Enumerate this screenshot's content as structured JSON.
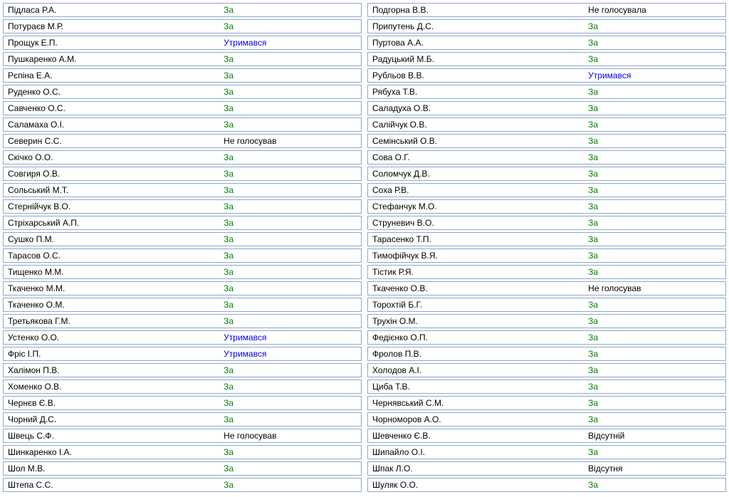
{
  "vote_classes": {
    "За": "vote-for",
    "Утримався": "vote-abstain",
    "Не голосував": "vote-novote",
    "Не голосувала": "vote-novote",
    "Відсутній": "vote-absent",
    "Відсутня": "vote-absent"
  },
  "left": [
    {
      "name": "Підласа Р.А.",
      "vote": "За"
    },
    {
      "name": "Потураєв М.Р.",
      "vote": "За"
    },
    {
      "name": "Прощук Е.П.",
      "vote": "Утримався"
    },
    {
      "name": "Пушкаренко А.М.",
      "vote": "За"
    },
    {
      "name": "Рєпіна Е.А.",
      "vote": "За"
    },
    {
      "name": "Руденко О.С.",
      "vote": "За"
    },
    {
      "name": "Савченко О.С.",
      "vote": "За"
    },
    {
      "name": "Саламаха О.І.",
      "vote": "За"
    },
    {
      "name": "Северин С.С.",
      "vote": "Не голосував"
    },
    {
      "name": "Скічко О.О.",
      "vote": "За"
    },
    {
      "name": "Совгиря О.В.",
      "vote": "За"
    },
    {
      "name": "Сольський М.Т.",
      "vote": "За"
    },
    {
      "name": "Стернійчук В.О.",
      "vote": "За"
    },
    {
      "name": "Стріхарський А.П.",
      "vote": "За"
    },
    {
      "name": "Сушко П.М.",
      "vote": "За"
    },
    {
      "name": "Тарасов О.С.",
      "vote": "За"
    },
    {
      "name": "Тищенко М.М.",
      "vote": "За"
    },
    {
      "name": "Ткаченко М.М.",
      "vote": "За"
    },
    {
      "name": "Ткаченко О.М.",
      "vote": "За"
    },
    {
      "name": "Третьякова Г.М.",
      "vote": "За"
    },
    {
      "name": "Устенко О.О.",
      "vote": "Утримався"
    },
    {
      "name": "Фріс І.П.",
      "vote": "Утримався"
    },
    {
      "name": "Халімон П.В.",
      "vote": "За"
    },
    {
      "name": "Хоменко О.В.",
      "vote": "За"
    },
    {
      "name": "Чернєв Є.В.",
      "vote": "За"
    },
    {
      "name": "Чорний Д.С.",
      "vote": "За"
    },
    {
      "name": "Швець С.Ф.",
      "vote": "Не голосував"
    },
    {
      "name": "Шинкаренко І.А.",
      "vote": "За"
    },
    {
      "name": "Шол М.В.",
      "vote": "За"
    },
    {
      "name": "Штепа С.С.",
      "vote": "За"
    }
  ],
  "right": [
    {
      "name": "Подгорна В.В.",
      "vote": "Не голосувала"
    },
    {
      "name": "Припутень Д.С.",
      "vote": "За"
    },
    {
      "name": "Пуртова А.А.",
      "vote": "За"
    },
    {
      "name": "Радуцький М.Б.",
      "vote": "За"
    },
    {
      "name": "Рубльов В.В.",
      "vote": "Утримався"
    },
    {
      "name": "Рябуха Т.В.",
      "vote": "За"
    },
    {
      "name": "Саладуха О.В.",
      "vote": "За"
    },
    {
      "name": "Салійчук О.В.",
      "vote": "За"
    },
    {
      "name": "Семінський О.В.",
      "vote": "За"
    },
    {
      "name": "Сова О.Г.",
      "vote": "За"
    },
    {
      "name": "Соломчук Д.В.",
      "vote": "За"
    },
    {
      "name": "Соха Р.В.",
      "vote": "За"
    },
    {
      "name": "Стефанчук М.О.",
      "vote": "За"
    },
    {
      "name": "Струневич В.О.",
      "vote": "За"
    },
    {
      "name": "Тарасенко Т.П.",
      "vote": "За"
    },
    {
      "name": "Тимофійчук В.Я.",
      "vote": "За"
    },
    {
      "name": "Тістик Р.Я.",
      "vote": "За"
    },
    {
      "name": "Ткаченко О.В.",
      "vote": "Не голосував"
    },
    {
      "name": "Торохтій Б.Г.",
      "vote": "За"
    },
    {
      "name": "Трухін О.М.",
      "vote": "За"
    },
    {
      "name": "Федієнко О.П.",
      "vote": "За"
    },
    {
      "name": "Фролов П.В.",
      "vote": "За"
    },
    {
      "name": "Холодов А.І.",
      "vote": "За"
    },
    {
      "name": "Циба Т.В.",
      "vote": "За"
    },
    {
      "name": "Чернявський С.М.",
      "vote": "За"
    },
    {
      "name": "Чорноморов А.О.",
      "vote": "За"
    },
    {
      "name": "Шевченко Є.В.",
      "vote": "Відсутній"
    },
    {
      "name": "Шипайло О.І.",
      "vote": "За"
    },
    {
      "name": "Шпак Л.О.",
      "vote": "Відсутня"
    },
    {
      "name": "Шуляк О.О.",
      "vote": "За"
    }
  ]
}
